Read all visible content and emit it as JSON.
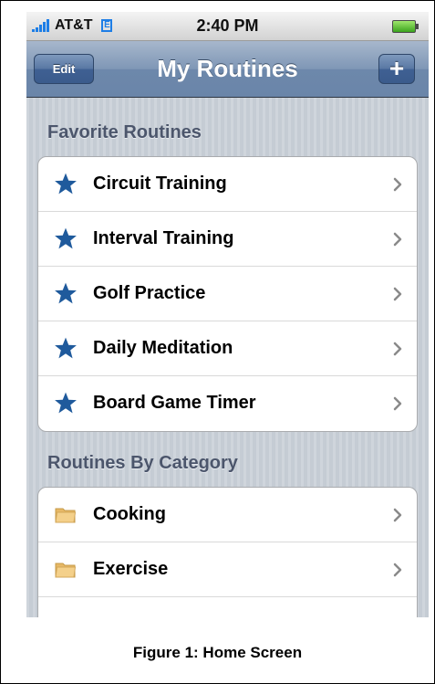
{
  "status_bar": {
    "carrier": "AT&T",
    "network": "E",
    "time": "2:40 PM",
    "signal_bars": 5,
    "battery_level": 1.0,
    "colors": {
      "network_icon": "#1e7ee6",
      "battery": "#3ba41d"
    }
  },
  "nav_bar": {
    "title": "My Routines",
    "edit_label": "Edit",
    "add_label": "+",
    "color": "#6d88ab"
  },
  "favorites": {
    "header": "Favorite Routines",
    "icon": "star-icon",
    "icon_color": "#1f5a9c",
    "items": [
      {
        "label": "Circuit Training"
      },
      {
        "label": "Interval Training"
      },
      {
        "label": "Golf Practice"
      },
      {
        "label": "Daily Meditation"
      },
      {
        "label": "Board Game Timer"
      }
    ]
  },
  "categories": {
    "header": "Routines By Category",
    "icon": "folder-icon",
    "icon_color": "#f4d08a",
    "items": [
      {
        "label": "Cooking"
      },
      {
        "label": "Exercise"
      },
      {
        "label": ""
      }
    ]
  },
  "caption": "Figure 1:  Home Screen"
}
